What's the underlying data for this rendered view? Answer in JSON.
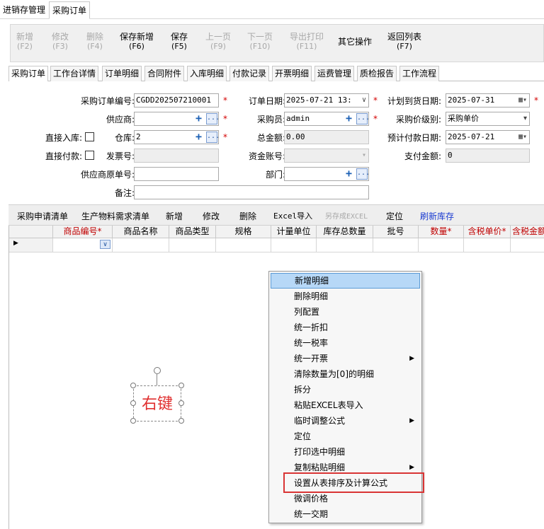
{
  "window_tabs": [
    "进销存管理",
    "采购订单"
  ],
  "toolbar": [
    {
      "label": "新增",
      "key": "(F2)",
      "enabled": false
    },
    {
      "label": "修改",
      "key": "(F3)",
      "enabled": false
    },
    {
      "label": "删除",
      "key": "(F4)",
      "enabled": false
    },
    {
      "label": "保存新增",
      "key": "(F6)",
      "enabled": true
    },
    {
      "label": "保存",
      "key": "(F5)",
      "enabled": true
    },
    {
      "label": "上一页",
      "key": "(F9)",
      "enabled": false
    },
    {
      "label": "下一页",
      "key": "(F10)",
      "enabled": false
    },
    {
      "label": "导出打印",
      "key": "(F11)",
      "enabled": false
    },
    {
      "label": "其它操作",
      "key": "",
      "enabled": true
    },
    {
      "label": "返回列表",
      "key": "(F7)",
      "enabled": true
    }
  ],
  "sub_tabs": [
    "采购订单",
    "工作台详情",
    "订单明细",
    "合同附件",
    "入库明细",
    "付款记录",
    "开票明细",
    "运费管理",
    "质检报告",
    "工作流程"
  ],
  "form": {
    "order_no_label": "采购订单编号:",
    "order_no": "CGDD202507210001",
    "order_date_label": "订单日期:",
    "order_date": "2025-07-21 13:",
    "plan_date_label": "计划到货日期:",
    "plan_date": "2025-07-31",
    "supplier_label": "供应商:",
    "supplier": "",
    "buyer_label": "采购员:",
    "buyer": "admin",
    "price_level_label": "采购价级别:",
    "price_level": "采购单价",
    "direct_in_label": "直接入库:",
    "warehouse_label": "仓库:",
    "warehouse": "2",
    "total_label": "总金额:",
    "total": "0.00",
    "pay_date_label": "预计付款日期:",
    "pay_date": "2025-07-21",
    "direct_pay_label": "直接付款:",
    "invoice_label": "发票号:",
    "invoice": "",
    "account_label": "资金账号:",
    "account": "",
    "paid_label": "支付金额:",
    "paid": "0",
    "supplier_no_label": "供应商原单号:",
    "supplier_no": "",
    "dept_label": "部门:",
    "dept": "",
    "remark_label": "备注:",
    "remark": "",
    "required_mark": "*",
    "plus": "+",
    "dots": "..."
  },
  "detail_toolbar": [
    "采购申请清单",
    "生产物料需求清单",
    "新增",
    "修改",
    "删除",
    "Excel导入",
    "另存成EXCEL",
    "定位",
    "刷新库存"
  ],
  "grid_columns": [
    {
      "label": "商品编号*",
      "red": true
    },
    {
      "label": "商品名称",
      "red": false
    },
    {
      "label": "商品类型",
      "red": false
    },
    {
      "label": "规格",
      "red": false
    },
    {
      "label": "计量单位",
      "red": false
    },
    {
      "label": "库存总数量",
      "red": false
    },
    {
      "label": "批号",
      "red": false
    },
    {
      "label": "数量*",
      "red": true
    },
    {
      "label": "含税单价*",
      "red": true
    },
    {
      "label": "含税金额",
      "red": true
    }
  ],
  "context_menu": [
    {
      "label": "新增明细",
      "submenu": false
    },
    {
      "label": "删除明细",
      "submenu": false
    },
    {
      "label": "列配置",
      "submenu": false
    },
    {
      "label": "统一折扣",
      "submenu": false
    },
    {
      "label": "统一税率",
      "submenu": false
    },
    {
      "label": "统一开票",
      "submenu": true
    },
    {
      "label": "清除数量为[0]的明细",
      "submenu": false
    },
    {
      "label": "拆分",
      "submenu": false
    },
    {
      "label": "粘贴EXCEL表导入",
      "submenu": false
    },
    {
      "label": "临时调整公式",
      "submenu": true
    },
    {
      "label": "定位",
      "submenu": false
    },
    {
      "label": "打印选中明细",
      "submenu": false
    },
    {
      "label": "复制粘贴明细",
      "submenu": true
    },
    {
      "label": "设置从表排序及计算公式",
      "submenu": false
    },
    {
      "label": "微调价格",
      "submenu": false
    },
    {
      "label": "统一交期",
      "submenu": false
    }
  ],
  "annotation": "右键",
  "colors": {
    "highlight": "#b7d8f7",
    "required": "#d40000",
    "callout": "#d93434"
  }
}
